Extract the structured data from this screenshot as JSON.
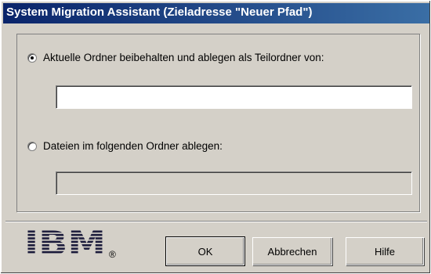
{
  "window": {
    "title": "System Migration Assistant (Zieladresse \"Neuer Pfad\")"
  },
  "options": [
    {
      "label": "Aktuelle Ordner beibehalten und ablegen als Teilordner von:",
      "selected": true,
      "field_value": "",
      "field_enabled": true
    },
    {
      "label": "Dateien im folgenden Ordner ablegen:",
      "selected": false,
      "field_value": "",
      "field_enabled": false
    }
  ],
  "footer": {
    "logo_text": "IBM",
    "logo_registered": "®",
    "buttons": {
      "ok": "OK",
      "cancel": "Abbrechen",
      "help": "Hilfe"
    }
  },
  "colors": {
    "title_bar": "#0a246a",
    "dialog_bg": "#d4d0c8",
    "field_enabled": "#ffffff",
    "field_disabled": "#d4d0c8"
  }
}
